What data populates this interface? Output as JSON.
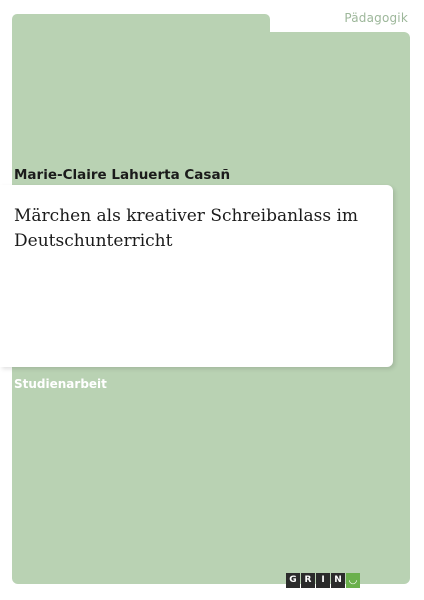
{
  "cover": {
    "category": "Pädagogik",
    "author": "Marie-Claire Lahuerta Casañ",
    "title": "Märchen als kreativer Schreibanlass im Deutschunterricht",
    "document_type": "Studienarbeit"
  },
  "logo": {
    "letters": [
      "G",
      "R",
      "I",
      "N"
    ],
    "smile_glyph": "◡",
    "colors": {
      "dark": "#2b2b2b",
      "accent": "#6ab04c"
    }
  },
  "colors": {
    "cover_green": "#b9d2b3",
    "category_text": "#9db79a",
    "text": "#1b1b1b"
  }
}
